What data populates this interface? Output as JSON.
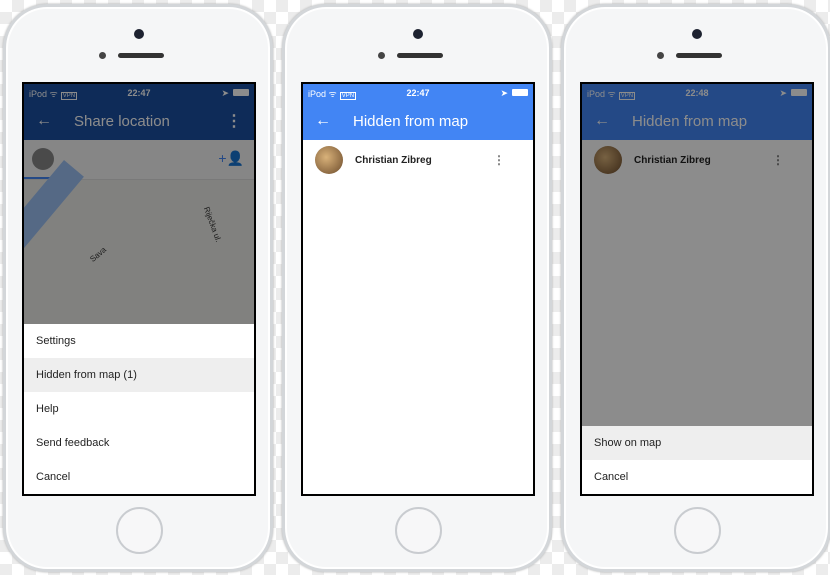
{
  "colors": {
    "appbar_dark": "#1a4fa0",
    "appbar": "#4285f4"
  },
  "phones": [
    {
      "status": {
        "carrier": "iPod",
        "vpn": "VPN",
        "time": "22:47"
      },
      "appbar": {
        "title": "Share location"
      },
      "map": {
        "river_label": "Sava",
        "street_label": "Riječka ul."
      },
      "sheet": [
        "Settings",
        "Hidden from map (1)",
        "Help",
        "Send feedback",
        "Cancel"
      ]
    },
    {
      "status": {
        "carrier": "iPod",
        "vpn": "VPN",
        "time": "22:47"
      },
      "appbar": {
        "title": "Hidden from map"
      },
      "contact": {
        "name": "Christian Zibreg"
      }
    },
    {
      "status": {
        "carrier": "iPod",
        "vpn": "VPN",
        "time": "22:48"
      },
      "appbar": {
        "title": "Hidden from map"
      },
      "contact": {
        "name": "Christian Zibreg"
      },
      "sheet": [
        "Show on map",
        "Cancel"
      ]
    }
  ]
}
